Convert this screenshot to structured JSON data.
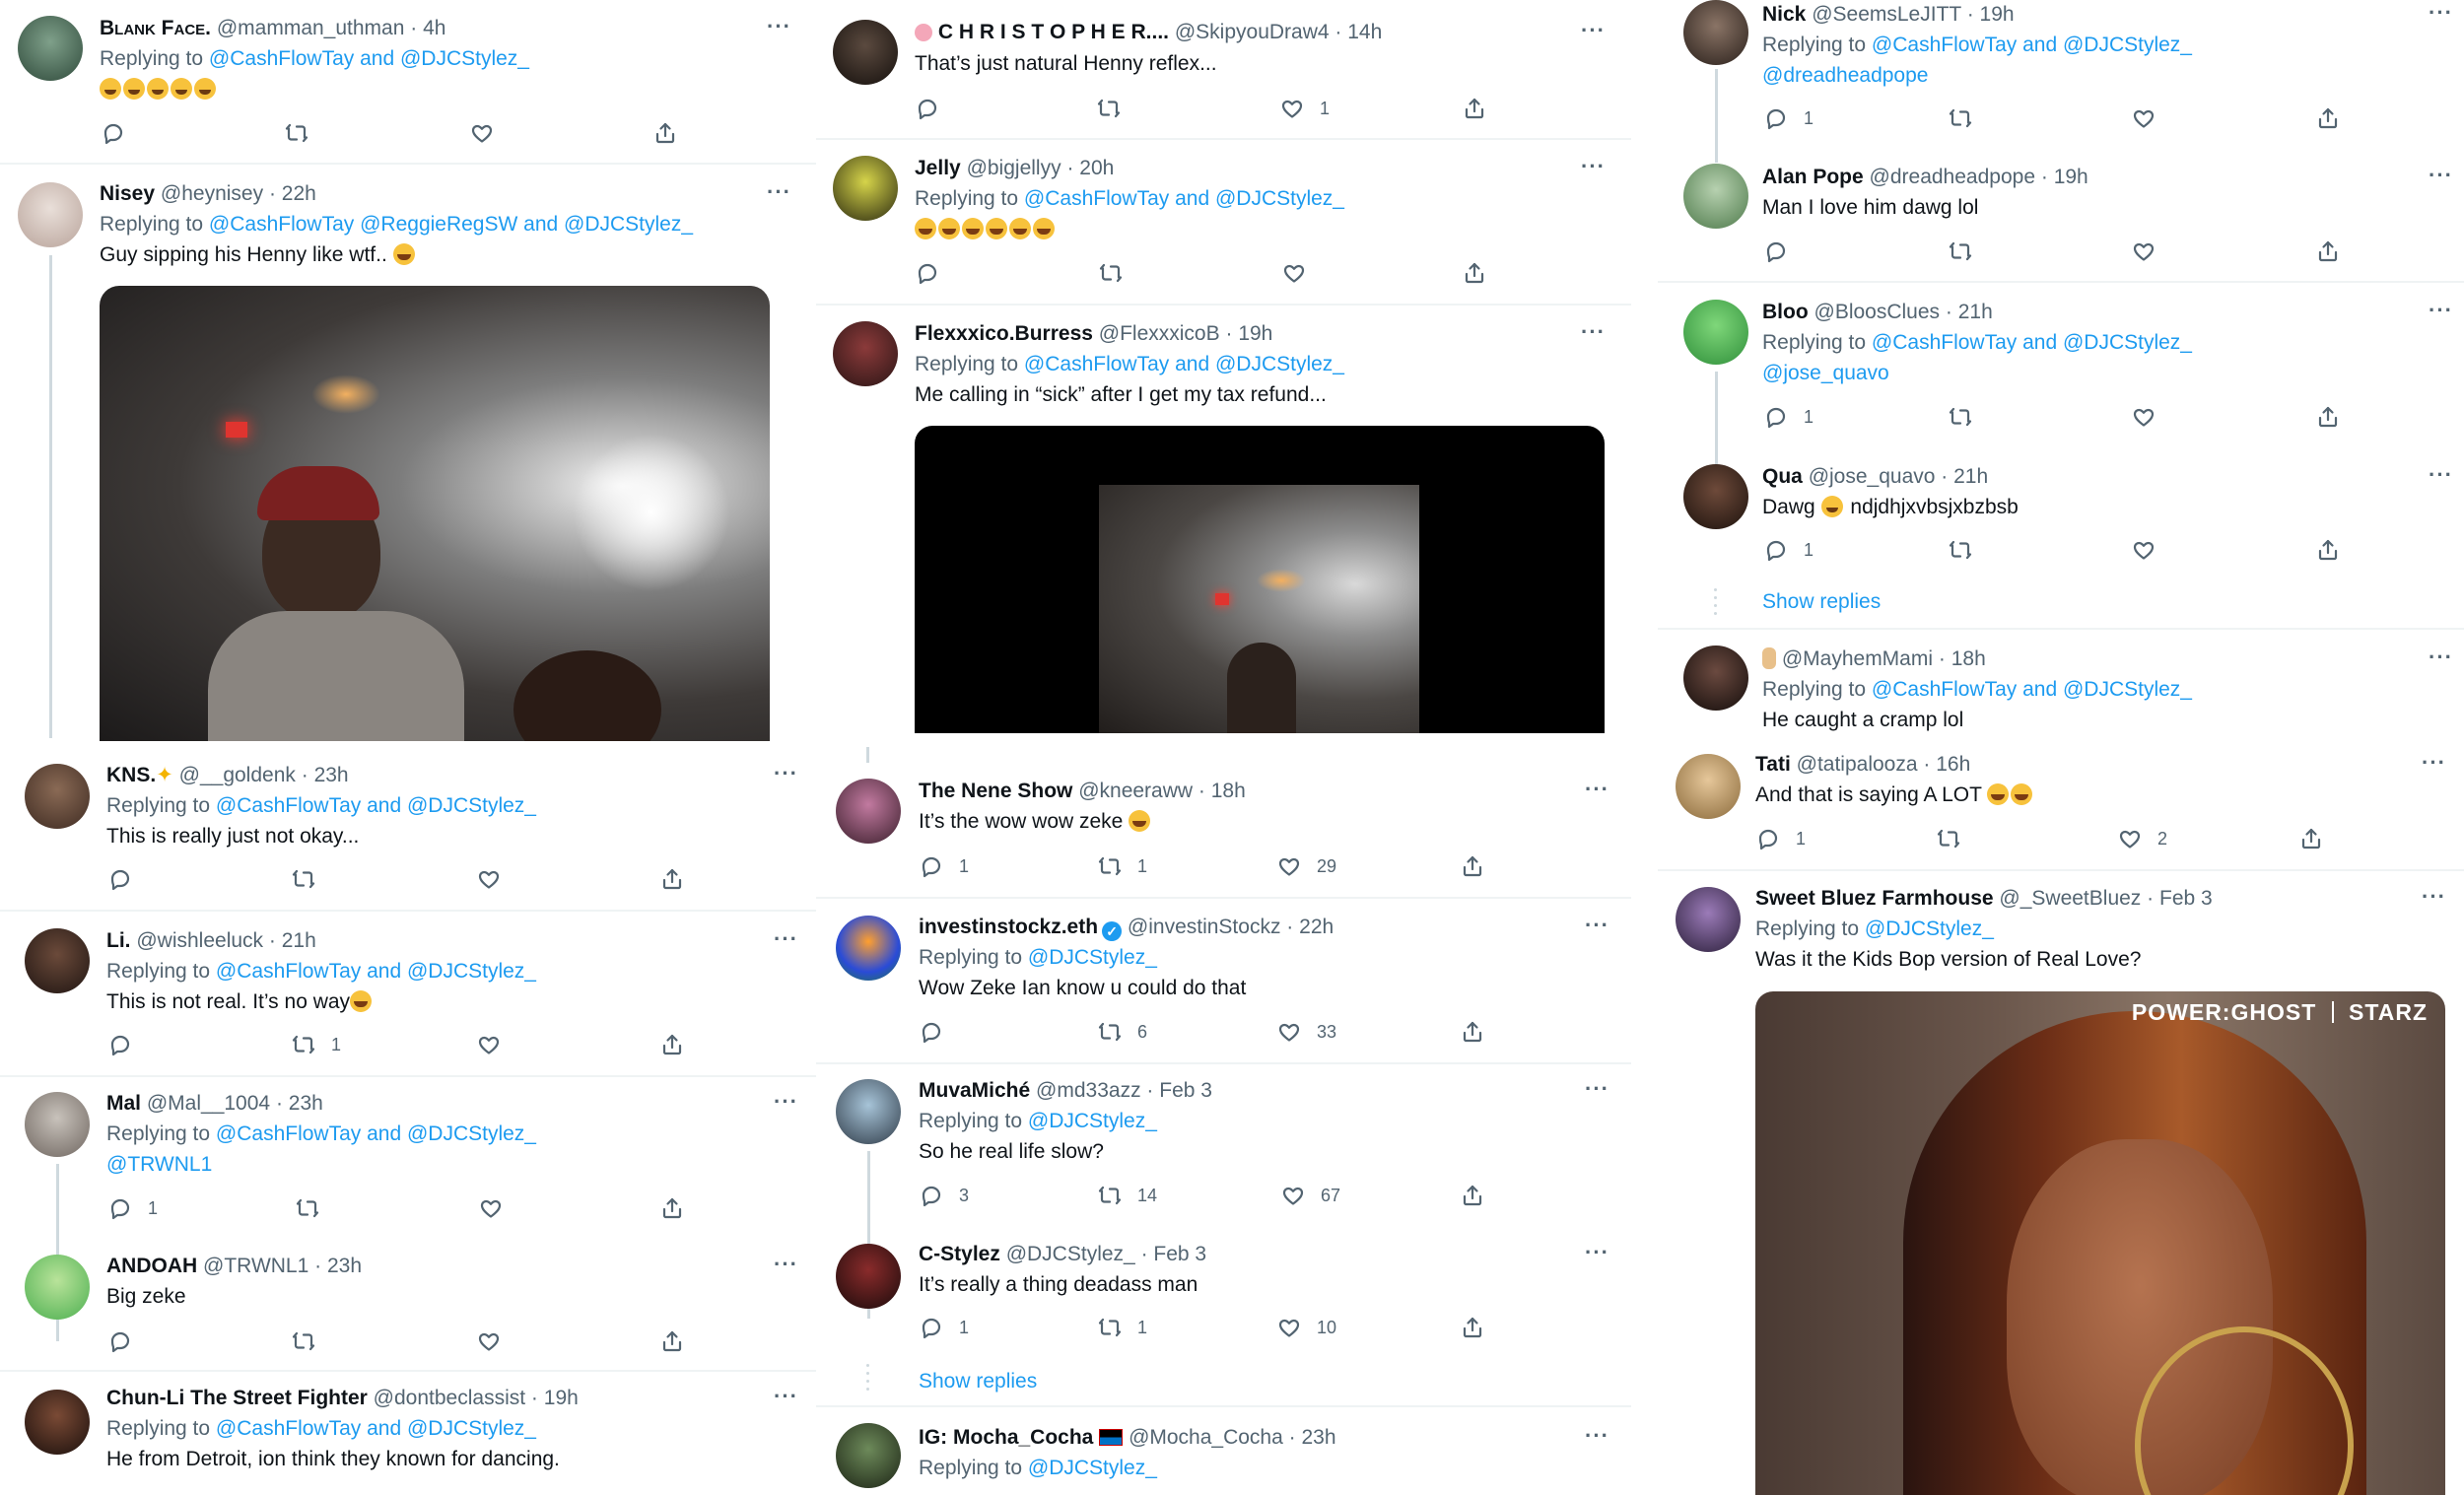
{
  "col1": {
    "blank": {
      "name": "Blank Face.",
      "handle": "@mamman_uthman",
      "time": "4h",
      "replying": "Replying to",
      "mentions": "@CashFlowTay and @DJCStylez_"
    },
    "nisey": {
      "name": "Nisey",
      "handle": "@heynisey",
      "time": "22h",
      "replying": "Replying to",
      "mentions": "@CashFlowTay @ReggieRegSW and @DJCStylez_",
      "text": "Guy sipping his Henny like wtf.."
    },
    "kns": {
      "name": "KNS.",
      "handle": "@__goldenk",
      "time": "23h",
      "replying": "Replying to",
      "mentions": "@CashFlowTay and @DJCStylez_",
      "text": "This is really just not okay..."
    },
    "li": {
      "name": "Li.",
      "handle": "@wishleeluck",
      "time": "21h",
      "replying": "Replying to",
      "mentions": "@CashFlowTay and @DJCStylez_",
      "text": "This is not real. It’s no way",
      "retweets": "1"
    },
    "mal": {
      "name": "Mal",
      "handle": "@Mal__1004",
      "time": "23h",
      "replying": "Replying to",
      "mentions": "@CashFlowTay and @DJCStylez_",
      "mentions2": "@TRWNL1",
      "replies": "1"
    },
    "andoah": {
      "name": "ANDOAH",
      "handle": "@TRWNL1",
      "time": "23h",
      "text": "Big zeke"
    },
    "chunli": {
      "name": "Chun-Li The Street Fighter",
      "handle": "@dontbeclassist",
      "time": "19h",
      "replying": "Replying to",
      "mentions": "@CashFlowTay and @DJCStylez_",
      "text": "He from Detroit, ion think they known for dancing."
    }
  },
  "col2": {
    "christopher": {
      "name": "C H R I S T O P H E R....",
      "handle": "@SkipyouDraw4",
      "time": "14h",
      "text": "That’s just natural Henny reflex...",
      "likes": "1"
    },
    "jelly": {
      "name": "Jelly",
      "handle": "@bigjellyy",
      "time": "20h",
      "replying": "Replying to",
      "mentions": "@CashFlowTay and @DJCStylez_"
    },
    "flex": {
      "name": "Flexxxico.Burress",
      "handle": "@FlexxxicoB",
      "time": "19h",
      "replying": "Replying to",
      "mentions": "@CashFlowTay and @DJCStylez_",
      "text": "Me calling in “sick” after I get my tax refund..."
    },
    "nene": {
      "name": "The Nene Show",
      "handle": "@kneeraww",
      "time": "18h",
      "text": "It’s the wow wow zeke",
      "replies": "1",
      "retweets": "1",
      "likes": "29"
    },
    "investin": {
      "name": "investinstockz.eth",
      "handle": "@investinStockz",
      "time": "22h",
      "replying": "Replying to",
      "mentions": "@DJCStylez_",
      "text": "Wow Zeke Ian know u could do that",
      "retweets": "6",
      "likes": "33"
    },
    "muva": {
      "name": "MuvaMiché",
      "handle": "@md33azz",
      "time": "Feb 3",
      "replying": "Replying to",
      "mentions": "@DJCStylez_",
      "text": "So he real life slow?",
      "replies": "3",
      "retweets": "14",
      "likes": "67"
    },
    "cstylez": {
      "name": "C-Stylez",
      "handle": "@DJCStylez_",
      "time": "Feb 3",
      "text": "It’s really a thing deadass man",
      "replies": "1",
      "retweets": "1",
      "likes": "10"
    },
    "showreplies": "Show replies",
    "mocha": {
      "name": "IG: Mocha_Cocha",
      "handle": "@Mocha_Cocha",
      "time": "23h",
      "replying": "Replying to",
      "mentions": "@DJCStylez_"
    }
  },
  "col3": {
    "nick": {
      "name": "Nick",
      "handle": "@SeemsLeJITT",
      "time": "19h",
      "replying": "Replying to",
      "mentions": "@CashFlowTay and @DJCStylez_",
      "mentions2": "@dreadheadpope",
      "replies": "1"
    },
    "alan": {
      "name": "Alan Pope",
      "handle": "@dreadheadpope",
      "time": "19h",
      "text": "Man I love him dawg lol"
    },
    "bloo": {
      "name": "Bloo",
      "handle": "@BloosClues",
      "time": "21h",
      "replying": "Replying to",
      "mentions": "@CashFlowTay and @DJCStylez_",
      "mentions2": "@jose_quavo",
      "replies": "1"
    },
    "qua": {
      "name": "Qua",
      "handle": "@jose_quavo",
      "time": "21h",
      "text_a": "Dawg",
      "text_b": "ndjdhjxvbsjxbzbsb",
      "replies": "1"
    },
    "showreplies": "Show replies",
    "mayhem": {
      "handle": "@MayhemMami",
      "time": "18h",
      "replying": "Replying to",
      "mentions": "@CashFlowTay and @DJCStylez_",
      "text": "He caught a cramp lol"
    },
    "tati": {
      "name": "Tati",
      "handle": "@tatipalooza",
      "time": "16h",
      "text": "And that is saying A LOT",
      "replies": "1",
      "likes": "2"
    },
    "sweet": {
      "name": "Sweet Bluez Farmhouse",
      "handle": "@_SweetBluez",
      "time": "Feb 3",
      "replying": "Replying to",
      "mentions": "@DJCStylez_",
      "text": "Was it the Kids Bop version of Real Love?"
    },
    "gif_brand": "POWER:GHOST",
    "gif_network": "STARZ"
  },
  "common": {
    "dot": "·",
    "more": "···"
  },
  "colors": {
    "link": "#1d9bf0",
    "muted": "#536471",
    "text": "#0f1419",
    "divider": "#eff3f4"
  }
}
